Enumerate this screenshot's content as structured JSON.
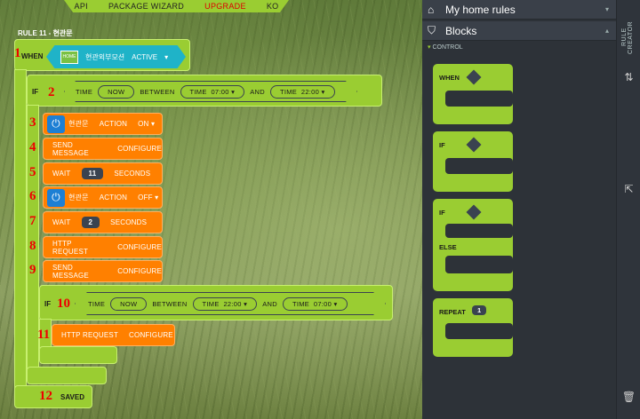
{
  "menu": {
    "api": "API",
    "package_wizard": "PACKAGE WIZARD",
    "upgrade": "UPGRADE",
    "ko": "KO"
  },
  "rule": {
    "title": "RULE 11 - 현관문"
  },
  "steps": [
    "1",
    "2",
    "3",
    "4",
    "5",
    "6",
    "7",
    "8",
    "9",
    "10",
    "11",
    "12"
  ],
  "when": {
    "label": "WHEN",
    "device_icon_text": "HOME",
    "device": "현관외부모션",
    "state": "ACTIVE"
  },
  "if1": {
    "label": "IF",
    "time": "TIME",
    "now": "NOW",
    "between": "BETWEEN",
    "t1_label": "TIME",
    "t1": "07:00",
    "and": "AND",
    "t2_label": "TIME",
    "t2": "22:00"
  },
  "actions": {
    "a1": {
      "device": "현관문",
      "action": "ACTION",
      "value": "ON"
    },
    "a2": {
      "text": "SEND MESSAGE",
      "config": "CONFIGURE"
    },
    "a3": {
      "wait": "WAIT",
      "value": "11",
      "unit": "SECONDS"
    },
    "a4": {
      "device": "현관문",
      "action": "ACTION",
      "value": "OFF"
    },
    "a5": {
      "wait": "WAIT",
      "value": "2",
      "unit": "SECONDS"
    },
    "a6": {
      "text": "HTTP REQUEST",
      "config": "CONFIGURE"
    },
    "a7": {
      "text": "SEND MESSAGE",
      "config": "CONFIGURE"
    }
  },
  "if2": {
    "label": "IF",
    "time": "TIME",
    "now": "NOW",
    "between": "BETWEEN",
    "t1_label": "TIME",
    "t1": "22:00",
    "and": "AND",
    "t2_label": "TIME",
    "t2": "07:00",
    "action": {
      "text": "HTTP REQUEST",
      "config": "CONFIGURE"
    }
  },
  "saved": "SAVED",
  "panel": {
    "my_rules": "My home rules",
    "blocks": "Blocks",
    "section": "CONTROL",
    "when": "WHEN",
    "if": "IF",
    "if_else_if": "IF",
    "else": "ELSE",
    "repeat": "REPEAT",
    "repeat_value": "1"
  },
  "sidebar": {
    "rule_creator": "RULE CREATOR"
  },
  "icons": [
    "home-icon",
    "tag-icon",
    "power-icon",
    "swap-icon",
    "export-icon",
    "trash-icon",
    "chevron-down-icon",
    "chevron-up-icon"
  ]
}
